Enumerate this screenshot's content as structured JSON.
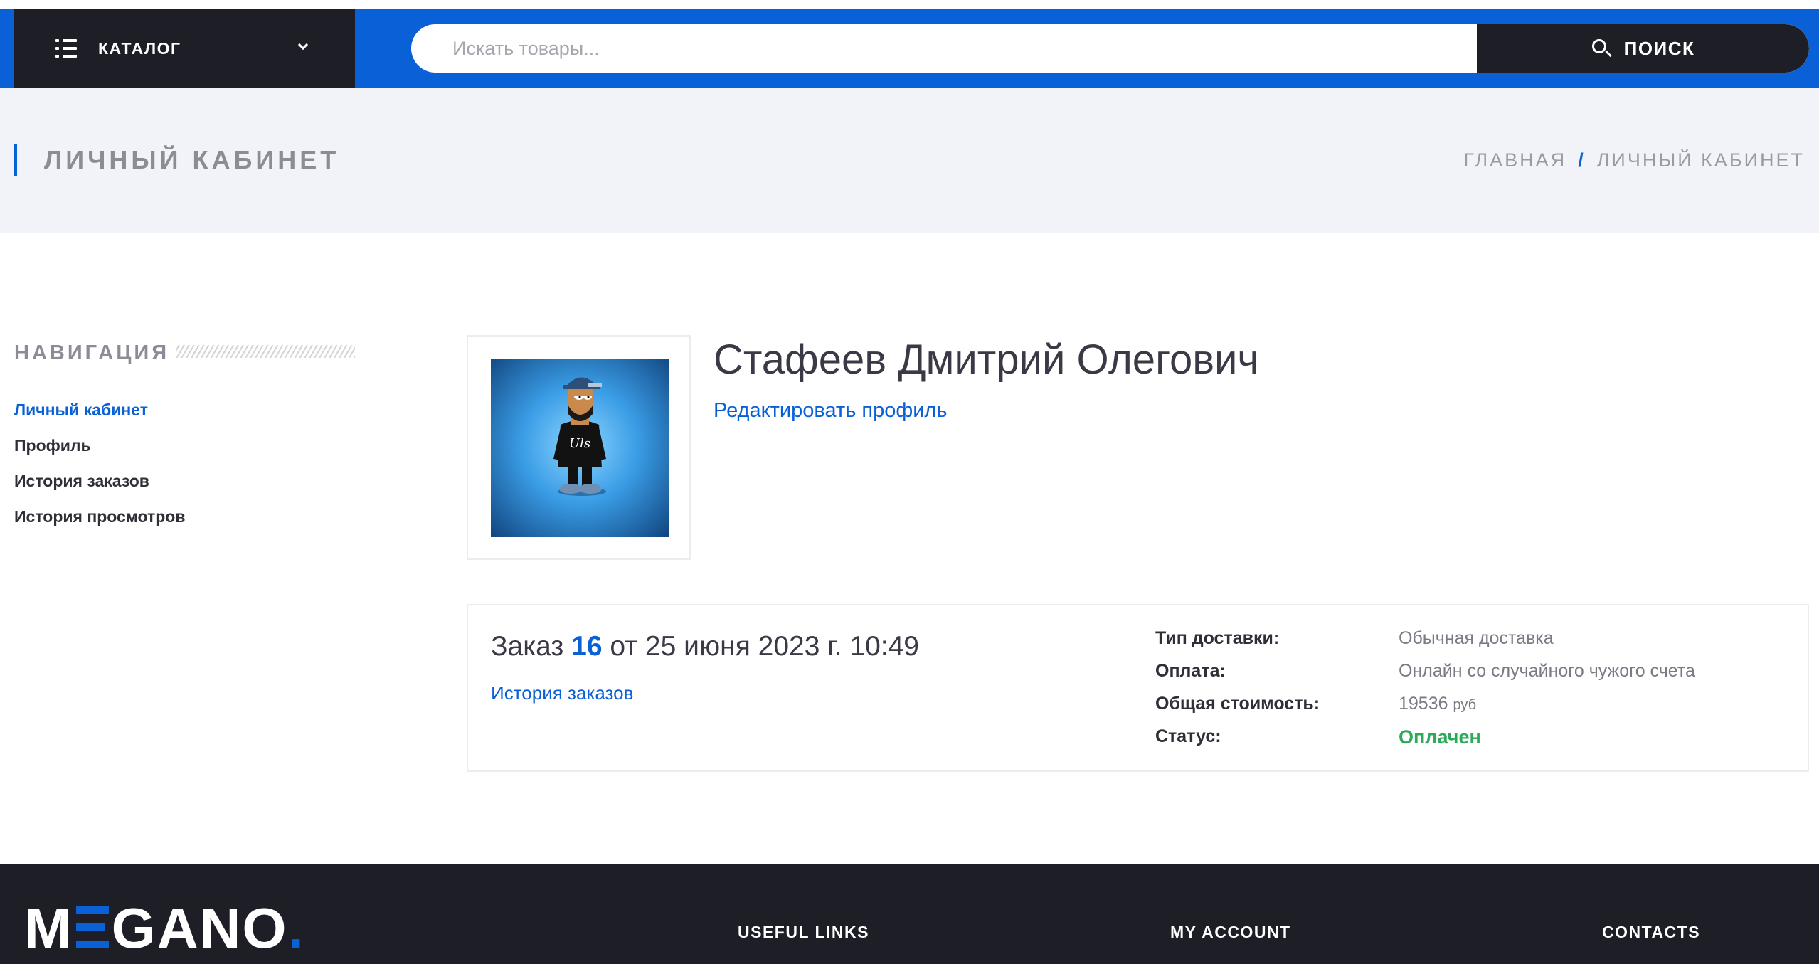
{
  "header": {
    "catalog_label": "КАТАЛОГ",
    "search_placeholder": "Искать товары...",
    "search_button": "ПОИСК",
    "accent_color": "#0a60d6",
    "dark_color": "#1e1f26"
  },
  "page": {
    "title": "ЛИЧНЫЙ КАБИНЕТ",
    "breadcrumb": [
      {
        "label": "ГЛАВНАЯ"
      },
      {
        "label": "ЛИЧНЫЙ КАБИНЕТ"
      }
    ],
    "breadcrumb_sep": "/"
  },
  "sidebar": {
    "title": "НАВИГАЦИЯ",
    "items": [
      {
        "label": "Личный кабинет",
        "active": true
      },
      {
        "label": "Профиль",
        "active": false
      },
      {
        "label": "История заказов",
        "active": false
      },
      {
        "label": "История просмотров",
        "active": false
      }
    ]
  },
  "profile": {
    "name": "Стафеев Дмитрий Олегович",
    "edit_link": "Редактировать профиль",
    "avatar_icon": "cartoon-avatar-icon"
  },
  "order": {
    "prefix": "Заказ",
    "number": "16",
    "date_text": "от 25 июня 2023 г. 10:49",
    "history_link": "История заказов",
    "details": {
      "delivery_label": "Тип доставки:",
      "delivery_value": "Обычная доставка",
      "payment_label": "Оплата:",
      "payment_value": "Онлайн со случайного чужого счета",
      "total_label": "Общая стоимость:",
      "total_value": "19536",
      "total_currency": "руб",
      "status_label": "Статус:",
      "status_value": "Оплачен",
      "status_color": "#2daa5a"
    }
  },
  "footer": {
    "logo_parts": [
      "M",
      "GANO",
      "."
    ],
    "headings": [
      "USEFUL LINKS",
      "MY ACCOUNT",
      "CONTACTS"
    ]
  }
}
